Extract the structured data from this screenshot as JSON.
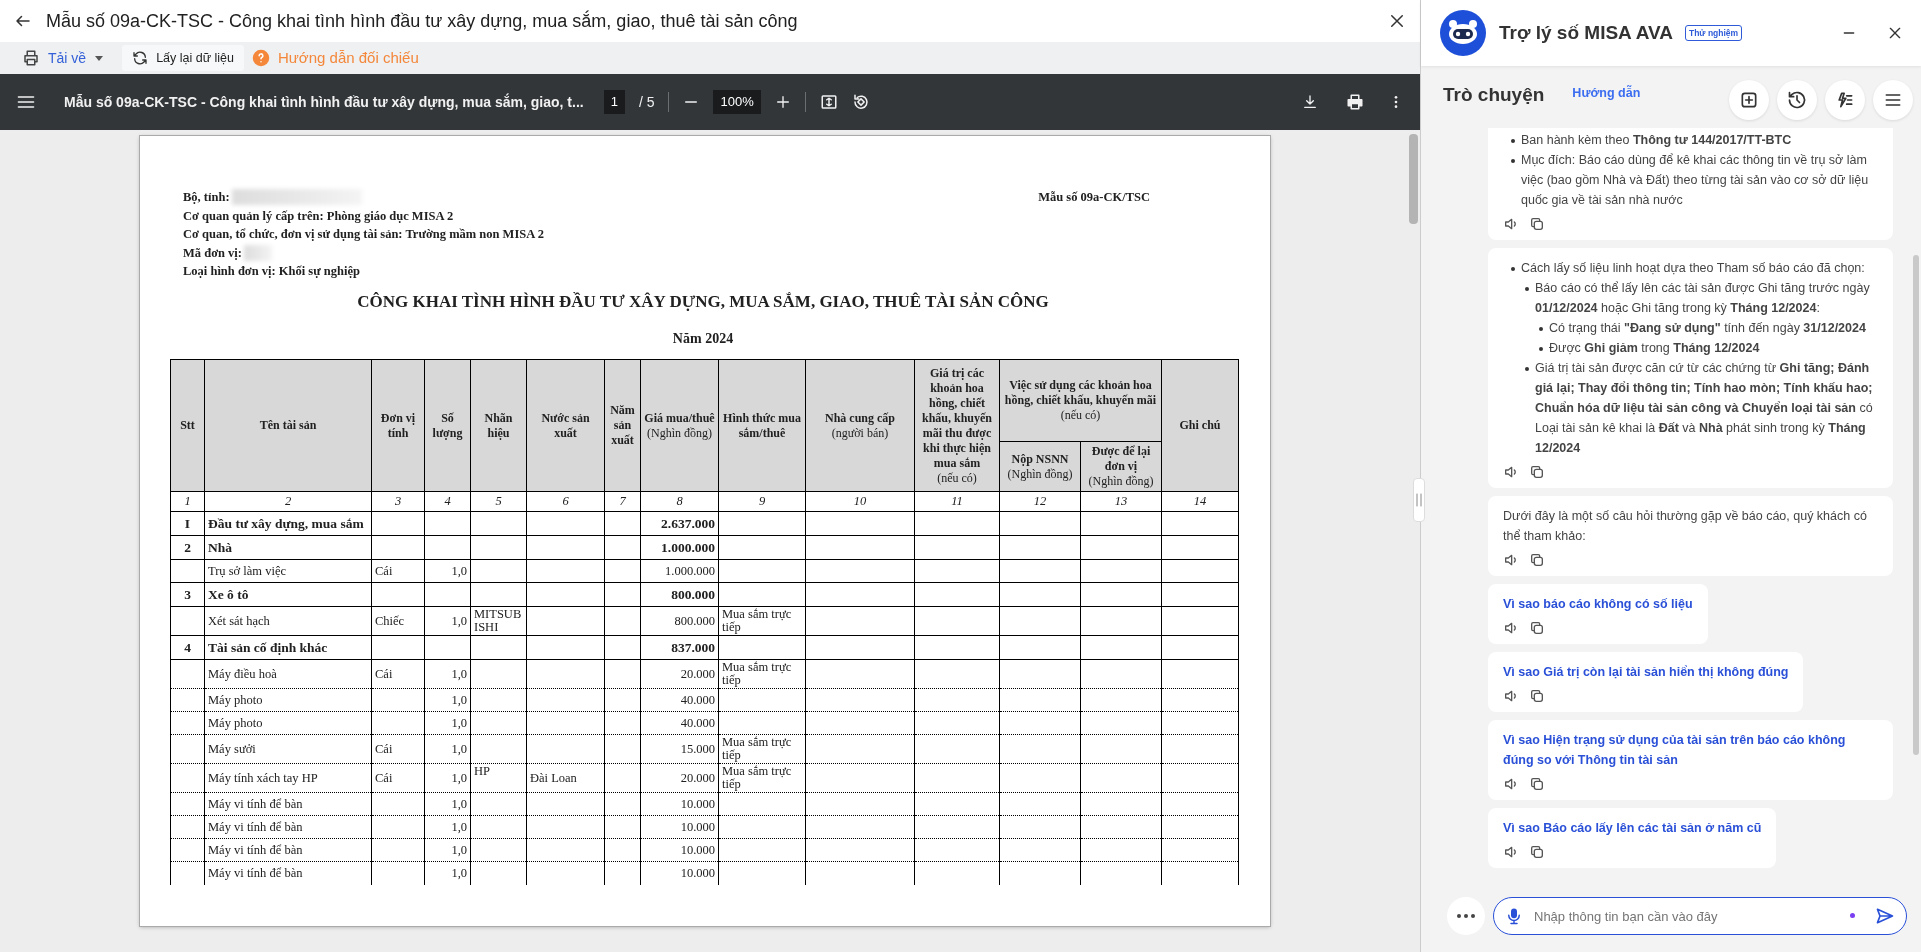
{
  "window": {
    "title": "Mẫu số 09a-CK-TSC - Công khai tình hình đầu tư xây dựng, mua sắm, giao, thuê tài sản công"
  },
  "toolbar": {
    "download": "Tải về",
    "reload": "Lấy lại dữ liệu",
    "guide": "Hướng dẫn đối chiếu"
  },
  "viewer": {
    "doc_title": "Mẫu số 09a-CK-TSC - Công khai tình hình đầu tư xây dựng, mua sắm, giao, t...",
    "page": "1",
    "pages": "/ 5",
    "zoom": "100%"
  },
  "document": {
    "form_no": "Mẫu số 09a-CK/TSC",
    "info": [
      {
        "text": "Bộ, tỉnh:",
        "redacted": true
      },
      {
        "text": "Cơ quan quản lý cấp trên: Phòng giáo dục MISA 2",
        "redacted": false
      },
      {
        "text": "Cơ quan, tổ chức, đơn vị sử dụng tài sản: Trường mầm non MISA 2",
        "redacted": false
      },
      {
        "text": "Mã đơn vị:",
        "redacted": true
      },
      {
        "text": "Loại hình đơn vị: Khối sự nghiệp",
        "redacted": false
      }
    ],
    "heading": "CÔNG KHAI TÌNH HÌNH ĐẦU TƯ XÂY DỰNG, MUA SẮM, GIAO, THUÊ TÀI SẢN CÔNG",
    "year": "Năm 2024",
    "table": {
      "columns": [
        {
          "label": "Stt"
        },
        {
          "label": "Tên tài sản"
        },
        {
          "label": "Đơn vị tính"
        },
        {
          "label": "Số lượng"
        },
        {
          "label": "Nhãn hiệu"
        },
        {
          "label": "Nước sản xuất"
        },
        {
          "label": "Năm sản xuất"
        },
        {
          "label": "Giá mua/thuê",
          "note": "(Nghìn đồng)"
        },
        {
          "label": "Hình thức mua sắm/thuê"
        },
        {
          "label": "Nhà cung cấp",
          "note": "(người bán)"
        },
        {
          "label": "Giá trị các khoản hoa hồng, chiết khấu, khuyến mãi thu được khi thực hiện mua sắm",
          "note": "(nếu có)"
        },
        {
          "label": "Việc sử dụng các khoản hoa hồng, chiết khấu, khuyến mãi",
          "note": "(nếu có)",
          "children": [
            {
              "label": "Nộp NSNN",
              "note": "(Nghìn đồng)"
            },
            {
              "label": "Được để lại đơn vị",
              "note": "(Nghìn đồng)"
            }
          ]
        },
        {
          "label": "Ghi chú"
        }
      ],
      "column_numbers": [
        "1",
        "2",
        "3",
        "4",
        "5",
        "6",
        "7",
        "8",
        "9",
        "10",
        "11",
        "12",
        "13",
        "14"
      ],
      "rows": [
        {
          "kind": "group",
          "stt": "I",
          "name": "Đầu tư xây dựng, mua sắm",
          "price": "2.637.000"
        },
        {
          "kind": "group",
          "stt": "2",
          "name": "Nhà",
          "price": "1.000.000"
        },
        {
          "kind": "item",
          "name": "Trụ sở làm việc",
          "unit": "Cái",
          "qty": "1,0",
          "price": "1.000.000"
        },
        {
          "kind": "group",
          "stt": "3",
          "name": "Xe ô tô",
          "price": "800.000"
        },
        {
          "kind": "item",
          "name": "Xét sát hạch",
          "unit": "Chiếc",
          "qty": "1,0",
          "brand": "MITSUBISHI",
          "price": "800.000",
          "method": "Mua sắm trực tiếp"
        },
        {
          "kind": "group",
          "stt": "4",
          "name": "Tài sản cố định khác",
          "price": "837.000"
        },
        {
          "kind": "item",
          "name": "Máy điều hoà",
          "unit": "Cái",
          "qty": "1,0",
          "price": "20.000",
          "method": "Mua sắm trực tiếp"
        },
        {
          "kind": "item",
          "name": "Máy photo",
          "qty": "1,0",
          "price": "40.000"
        },
        {
          "kind": "item",
          "name": "Máy photo",
          "qty": "1,0",
          "price": "40.000"
        },
        {
          "kind": "item",
          "name": "Máy sưởi",
          "unit": "Cái",
          "qty": "1,0",
          "price": "15.000",
          "method": "Mua sắm trực tiếp"
        },
        {
          "kind": "item",
          "name": "Máy tính xách tay HP",
          "unit": "Cái",
          "qty": "1,0",
          "brand": "HP",
          "country": "Đài Loan",
          "price": "20.000",
          "method": "Mua sắm trực tiếp"
        },
        {
          "kind": "item",
          "name": "Máy vi tính để bàn",
          "qty": "1,0",
          "price": "10.000"
        },
        {
          "kind": "item",
          "name": "Máy vi tính để bàn",
          "qty": "1,0",
          "price": "10.000"
        },
        {
          "kind": "item",
          "name": "Máy vi tính để bàn",
          "qty": "1,0",
          "price": "10.000"
        },
        {
          "kind": "item",
          "name": "Máy vi tính để bàn",
          "qty": "1,0",
          "price": "10.000"
        }
      ]
    }
  },
  "assistant": {
    "title": "Trợ lý số MISA AVA",
    "badge": "Thử nghiệm",
    "section": "Trò chuyện",
    "guide_link": "Hướng dẫn",
    "messages": [
      {
        "kind": "bullets",
        "items": [
          {
            "text": "Ban hành kèm theo **Thông tư 144/2017/TT-BTC**"
          },
          {
            "text": "Mục đích: Báo cáo dùng để kê khai các thông tin về trụ sở làm việc (bao gồm Nhà và Đất) theo từng tài sản vào cơ sở dữ liệu quốc gia về tài sản nhà nước"
          }
        ]
      },
      {
        "kind": "bullets",
        "items": [
          {
            "text": "Cách lấy số liệu linh hoạt dựa theo Tham số báo cáo đã chọn:",
            "children": [
              {
                "text": "Báo cáo có thể lấy lên các tài sản được Ghi tăng trước ngày **01/12/2024** hoặc Ghi tăng trong kỳ **Tháng 12/2024**:",
                "children": [
                  {
                    "text": "Có trạng thái **\"Đang sử dụng\"** tính đến ngày **31/12/2024**"
                  },
                  {
                    "text": "Được **Ghi giảm** trong **Tháng 12/2024**"
                  }
                ]
              },
              {
                "text": "Giá trị tài sản được căn cứ từ các chứng từ **Ghi tăng; Đánh giá lại; Thay đổi thông tin; Tính hao mòn; Tính khấu hao; Chuẩn hóa dữ liệu tài sản công và Chuyển loại tài sản** có Loại tài sản kê khai là **Đất** và **Nhà** phát sinh trong kỳ **Tháng 12/2024**"
              }
            ]
          }
        ]
      },
      {
        "kind": "text",
        "text": "Dưới đây là một số câu hỏi thường gặp về báo cáo, quý khách có thể tham khảo:"
      },
      {
        "kind": "suggestion",
        "text": "Vì sao báo cáo không có số liệu"
      },
      {
        "kind": "suggestion",
        "text": "Vì sao Giá trị còn lại tài sản hiển thị không đúng"
      },
      {
        "kind": "suggestion",
        "text": "Vì sao Hiện trạng sử dụng của tài sản trên báo cáo không đúng so với Thông tin tài sản"
      },
      {
        "kind": "suggestion",
        "text": "Vì sao Báo cáo lấy lên các tài sản ở năm cũ"
      }
    ],
    "input": {
      "placeholder": "Nhập thông tin bạn cần vào đây"
    }
  }
}
